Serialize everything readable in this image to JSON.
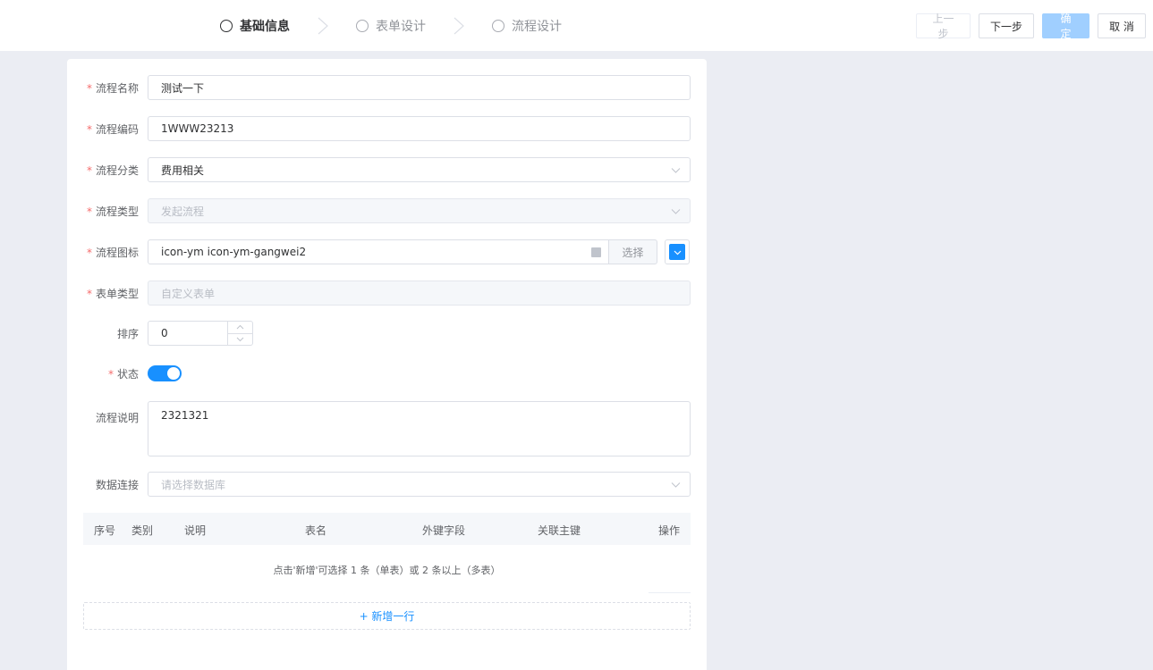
{
  "steps": [
    {
      "label": "基础信息",
      "active": true
    },
    {
      "label": "表单设计",
      "active": false
    },
    {
      "label": "流程设计",
      "active": false
    }
  ],
  "actions": {
    "prev": "上一步",
    "next": "下一步",
    "confirm": "确 定",
    "cancel": "取 消"
  },
  "form": {
    "name": {
      "label": "流程名称",
      "value": "测试一下"
    },
    "code": {
      "label": "流程编码",
      "value": "1WWW23213"
    },
    "category": {
      "label": "流程分类",
      "value": "费用相关"
    },
    "type": {
      "label": "流程类型",
      "placeholder": "发起流程"
    },
    "icon": {
      "label": "流程图标",
      "value": "icon-ym icon-ym-gangwei2",
      "select": "选择",
      "color": "#1890ff"
    },
    "form_type": {
      "label": "表单类型",
      "placeholder": "自定义表单"
    },
    "sort": {
      "label": "排序",
      "value": "0"
    },
    "status": {
      "label": "状态",
      "on": true
    },
    "description": {
      "label": "流程说明",
      "value": "2321321"
    },
    "db": {
      "label": "数据连接",
      "placeholder": "请选择数据库"
    }
  },
  "table": {
    "columns": [
      "序号",
      "类别",
      "说明",
      "表名",
      "外键字段",
      "关联主键",
      "操作"
    ],
    "empty_text": "点击'新增'可选择 1 条（单表）或 2 条以上（多表）",
    "add_label": "+ 新增一行"
  },
  "colors": {
    "primary": "#1890ff",
    "required": "#f56c6c"
  }
}
